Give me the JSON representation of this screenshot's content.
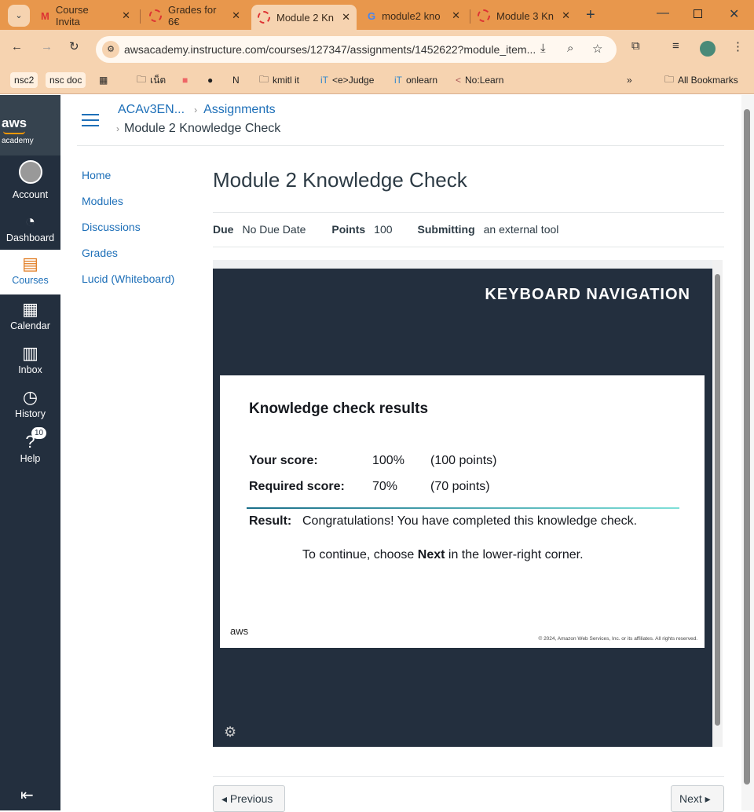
{
  "browser": {
    "tabs": [
      {
        "title": "Course Invita",
        "icon": "gmail-icon"
      },
      {
        "title": "Grades for 6€",
        "icon": "canvas-icon"
      },
      {
        "title": "Module 2 Kn",
        "icon": "canvas-icon",
        "active": true
      },
      {
        "title": "module2 kno",
        "icon": "google-icon"
      },
      {
        "title": "Module 3 Kn",
        "icon": "canvas-icon"
      }
    ],
    "url": "awsacademy.instructure.com/courses/127347/assignments/1452622?module_item...",
    "bookmarks": [
      "nsc2",
      "nsc doc",
      "เน็ต",
      "kmitl it",
      "<e>Judge",
      "onlearn",
      "No:Learn"
    ],
    "all_bookmarks": "All Bookmarks"
  },
  "global_nav": {
    "logo": "aws academy",
    "items": [
      {
        "label": "Account"
      },
      {
        "label": "Dashboard"
      },
      {
        "label": "Courses",
        "active": true
      },
      {
        "label": "Calendar"
      },
      {
        "label": "Inbox"
      },
      {
        "label": "History"
      },
      {
        "label": "Help",
        "badge": "10"
      }
    ]
  },
  "breadcrumb": {
    "course": "ACAv3EN...",
    "section": "Assignments",
    "current": "Module 2 Knowledge Check"
  },
  "course_nav": [
    "Home",
    "Modules",
    "Discussions",
    "Grades",
    "Lucid (Whiteboard)"
  ],
  "assignment": {
    "title": "Module 2 Knowledge Check",
    "due_label": "Due",
    "due": "No Due Date",
    "points_label": "Points",
    "points": "100",
    "submitting_label": "Submitting",
    "submitting": "an external tool"
  },
  "tool": {
    "header": "KEYBOARD NAVIGATION",
    "results_title": "Knowledge check results",
    "your_score_label": "Your score:",
    "your_score": "100%",
    "your_points": "(100 points)",
    "required_label": "Required score:",
    "required": "70%",
    "required_points": "(70 points)",
    "result_label": "Result:",
    "result": "Congratulations! You have completed this knowledge check.",
    "continue_pre": "To continue, choose ",
    "continue_bold": "Next",
    "continue_post": " in the lower-right corner.",
    "aws": "aws",
    "copyright": "© 2024, Amazon Web Services, Inc. or its affiliates. All rights reserved."
  },
  "footer": {
    "previous": "◂ Previous",
    "next": "Next ▸"
  },
  "colors": {
    "accent": "#1d6fb8",
    "sidebar": "#232f3e",
    "tabstrip": "#e8974c"
  }
}
